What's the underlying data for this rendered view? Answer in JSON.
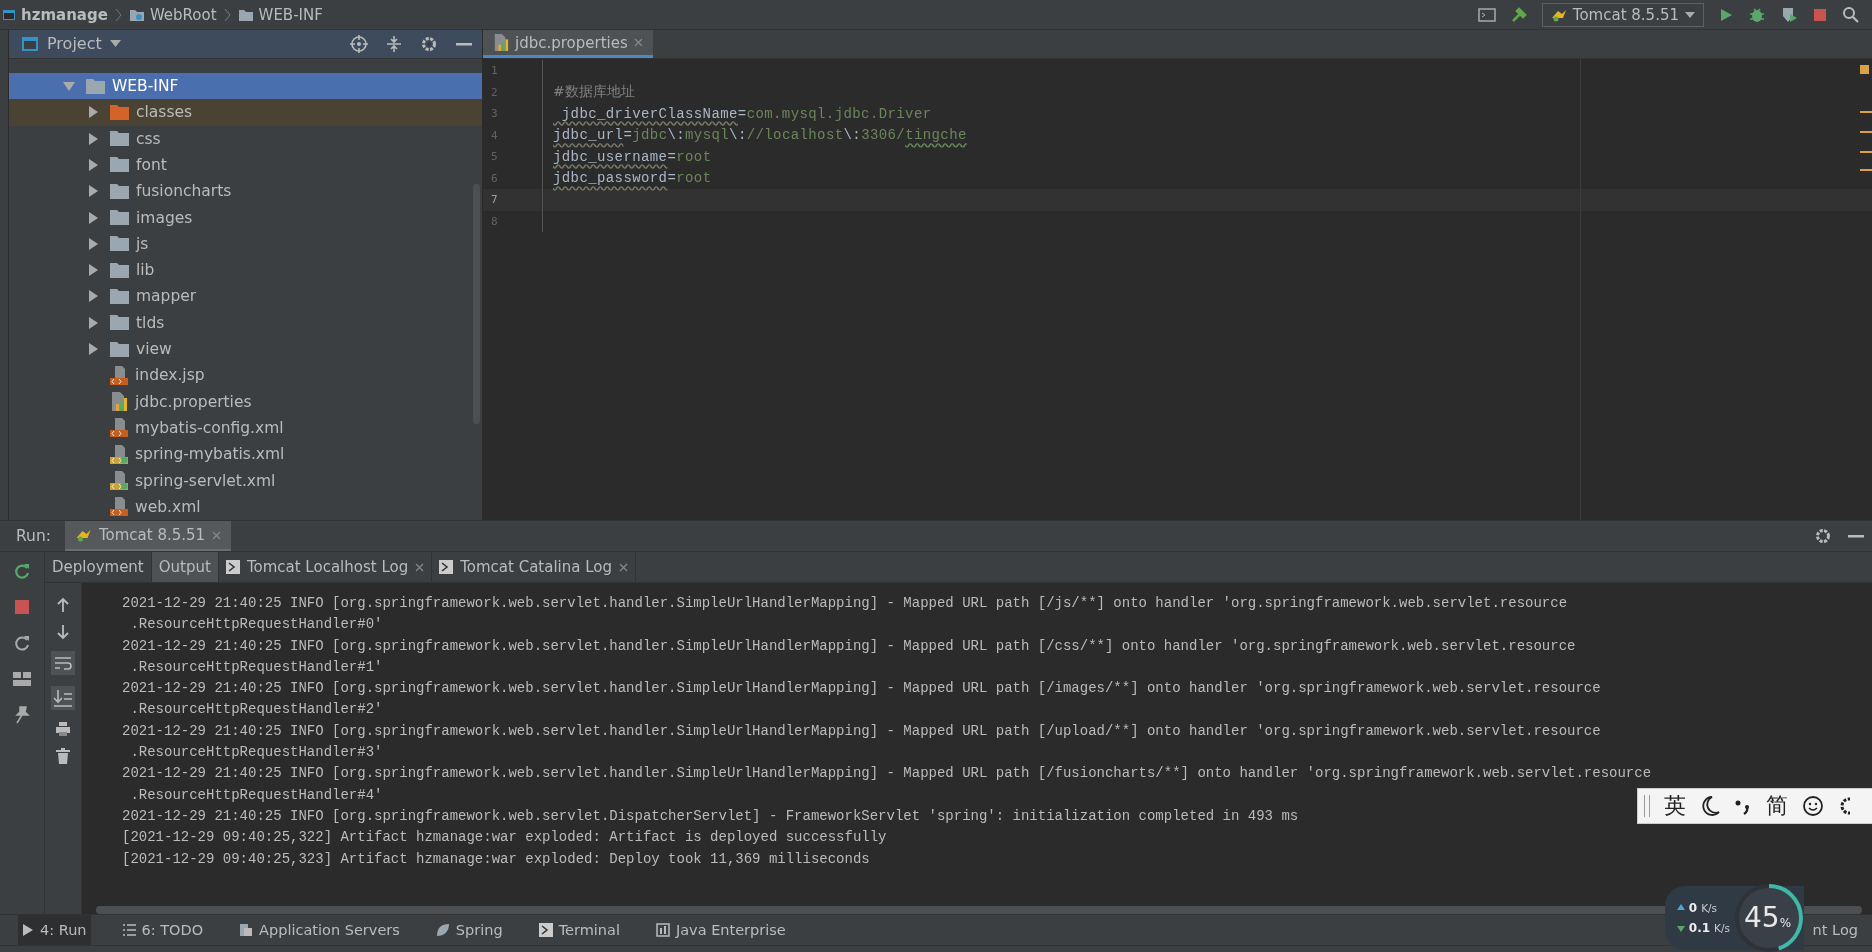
{
  "breadcrumbs": [
    {
      "label": "hzmanage",
      "kind": "project"
    },
    {
      "label": "WebRoot",
      "kind": "web"
    },
    {
      "label": "WEB-INF",
      "kind": "folder"
    }
  ],
  "run_config": {
    "label": "Tomcat 8.5.51"
  },
  "project_panel": {
    "title": "Project"
  },
  "tree": [
    {
      "label": "WEB-INF",
      "kind": "folder",
      "expanded": true,
      "selected": true,
      "children": [
        {
          "label": "classes",
          "kind": "excluded-folder",
          "expanded": false,
          "selected": false
        },
        {
          "label": "css",
          "kind": "folder",
          "expanded": false,
          "selected": false
        },
        {
          "label": "font",
          "kind": "folder",
          "expanded": false,
          "selected": false
        },
        {
          "label": "fusioncharts",
          "kind": "folder",
          "expanded": false,
          "selected": false
        },
        {
          "label": "images",
          "kind": "folder",
          "expanded": false,
          "selected": false
        },
        {
          "label": "js",
          "kind": "folder",
          "expanded": false,
          "selected": false
        },
        {
          "label": "lib",
          "kind": "folder",
          "expanded": false,
          "selected": false
        },
        {
          "label": "mapper",
          "kind": "folder",
          "expanded": false,
          "selected": false
        },
        {
          "label": "tlds",
          "kind": "folder",
          "expanded": false,
          "selected": false
        },
        {
          "label": "view",
          "kind": "folder",
          "expanded": false,
          "selected": false
        },
        {
          "label": "index.jsp",
          "kind": "jsp",
          "selected": false
        },
        {
          "label": "jdbc.properties",
          "kind": "properties",
          "selected": false
        },
        {
          "label": "mybatis-config.xml",
          "kind": "xml",
          "selected": false
        },
        {
          "label": "spring-mybatis.xml",
          "kind": "spring-xml",
          "selected": false
        },
        {
          "label": "spring-servlet.xml",
          "kind": "spring-xml",
          "selected": false
        },
        {
          "label": "web.xml",
          "kind": "web-xml",
          "selected": false
        }
      ]
    }
  ],
  "editor_tabs": [
    {
      "label": "jdbc.properties",
      "selected": true
    }
  ],
  "code_lines": [
    {
      "number": "1",
      "current": false
    },
    {
      "number": "2",
      "current": false,
      "segments": [
        {
          "kind": "comment",
          "text": "#数据库地址"
        }
      ]
    },
    {
      "number": "3",
      "current": false,
      "segments": [
        {
          "kind": "key",
          "text": " jdbc_driverClassName"
        },
        {
          "kind": "sep",
          "text": "="
        },
        {
          "kind": "value",
          "text": "com.mysql.jdbc.Driver"
        }
      ]
    },
    {
      "number": "4",
      "current": false,
      "segments": [
        {
          "kind": "key",
          "text": "jdbc_url"
        },
        {
          "kind": "sep",
          "text": "="
        },
        {
          "kind": "value",
          "text": "jdbc"
        },
        {
          "kind": "sep",
          "text": "\\:"
        },
        {
          "kind": "value",
          "text": "mysql"
        },
        {
          "kind": "sep",
          "text": "\\:"
        },
        {
          "kind": "value",
          "text": "//localhost"
        },
        {
          "kind": "sep",
          "text": "\\:"
        },
        {
          "kind": "value",
          "text": "3306/"
        },
        {
          "kind": "typo",
          "text": "tingche"
        }
      ]
    },
    {
      "number": "5",
      "current": false,
      "segments": [
        {
          "kind": "key",
          "text": "jdbc_username"
        },
        {
          "kind": "sep",
          "text": "="
        },
        {
          "kind": "value",
          "text": "root"
        }
      ]
    },
    {
      "number": "6",
      "current": false,
      "segments": [
        {
          "kind": "key",
          "text": "jdbc_password"
        },
        {
          "kind": "sep",
          "text": "="
        },
        {
          "kind": "value",
          "text": "root"
        }
      ]
    },
    {
      "number": "7",
      "current": true
    },
    {
      "number": "8",
      "current": false
    }
  ],
  "run_panel": {
    "label": "Run:",
    "tabs": [
      {
        "label": "Tomcat 8.5.51",
        "selected": true
      }
    ],
    "sub_tabs": [
      {
        "label": "Deployment",
        "selected": false,
        "closable": false,
        "kind": "plain"
      },
      {
        "label": "Output",
        "selected": true,
        "closable": false,
        "kind": "plain"
      },
      {
        "label": "Tomcat Localhost Log",
        "selected": false,
        "closable": true,
        "kind": "log"
      },
      {
        "label": "Tomcat Catalina Log",
        "selected": false,
        "closable": true,
        "kind": "log"
      }
    ]
  },
  "console_lines": [
    "2021-12-29 21:40:25 INFO [org.springframework.web.servlet.handler.SimpleUrlHandlerMapping] - Mapped URL path [/js/**] onto handler 'org.springframework.web.servlet.resource",
    " .ResourceHttpRequestHandler#0'",
    "2021-12-29 21:40:25 INFO [org.springframework.web.servlet.handler.SimpleUrlHandlerMapping] - Mapped URL path [/css/**] onto handler 'org.springframework.web.servlet.resource",
    " .ResourceHttpRequestHandler#1'",
    "2021-12-29 21:40:25 INFO [org.springframework.web.servlet.handler.SimpleUrlHandlerMapping] - Mapped URL path [/images/**] onto handler 'org.springframework.web.servlet.resource",
    " .ResourceHttpRequestHandler#2'",
    "2021-12-29 21:40:25 INFO [org.springframework.web.servlet.handler.SimpleUrlHandlerMapping] - Mapped URL path [/upload/**] onto handler 'org.springframework.web.servlet.resource",
    " .ResourceHttpRequestHandler#3'",
    "2021-12-29 21:40:25 INFO [org.springframework.web.servlet.handler.SimpleUrlHandlerMapping] - Mapped URL path [/fusioncharts/**] onto handler 'org.springframework.web.servlet.resource",
    " .ResourceHttpRequestHandler#4'",
    "2021-12-29 21:40:25 INFO [org.springframework.web.servlet.DispatcherServlet] - FrameworkServlet 'spring': initialization completed in 493 ms",
    "[2021-12-29 09:40:25,322] Artifact hzmanage:war exploded: Artifact is deployed successfully",
    "[2021-12-29 09:40:25,323] Artifact hzmanage:war exploded: Deploy took 11,369 milliseconds"
  ],
  "tool_strip": [
    {
      "label": "4: Run",
      "kind": "run",
      "selected": true
    },
    {
      "label": "6: TODO",
      "kind": "todo",
      "selected": false
    },
    {
      "label": "Application Servers",
      "kind": "servers",
      "selected": false
    },
    {
      "label": "Spring",
      "kind": "spring",
      "selected": false
    },
    {
      "label": "Terminal",
      "kind": "terminal",
      "selected": false
    },
    {
      "label": "Java Enterprise",
      "kind": "enterprise",
      "selected": false
    }
  ],
  "tool_strip_right": "nt Log",
  "net_widget": {
    "up": {
      "value": "0",
      "unit": "K/s"
    },
    "down": {
      "value": "0.1",
      "unit": "K/s"
    },
    "percent": "45",
    "percent_unit": "%",
    "level": 0.45
  },
  "ime_bar": {
    "language": "英",
    "script": "简"
  }
}
